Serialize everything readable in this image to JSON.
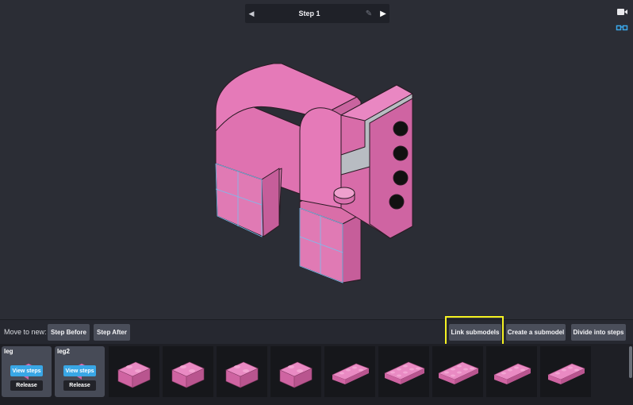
{
  "step_nav": {
    "title": "Step 1",
    "prev_icon": "triangle-left",
    "next_icon": "triangle-right",
    "edit_icon": "pencil"
  },
  "side_tools": [
    {
      "name": "camera-icon"
    },
    {
      "name": "glasses-icon",
      "color": "#3aa6e8"
    }
  ],
  "toolbar": {
    "move_label": "Move to new:",
    "step_before": "Step Before",
    "step_after": "Step After",
    "link_submodels": "Link submodels",
    "create_submodel": "Create a submodel",
    "divide_steps": "Divide into steps"
  },
  "submodels": [
    {
      "name": "leg",
      "view": "View steps",
      "release": "Release"
    },
    {
      "name": "leg2",
      "view": "View steps",
      "release": "Release"
    }
  ],
  "parts": [
    {
      "kind": "brick-1x2"
    },
    {
      "kind": "brick-1x2"
    },
    {
      "kind": "brick-1x2"
    },
    {
      "kind": "brick-1x2"
    },
    {
      "kind": "plate-1x4"
    },
    {
      "kind": "plate-2x4"
    },
    {
      "kind": "plate-2x4"
    },
    {
      "kind": "plate-1x4"
    },
    {
      "kind": "plate-1x4"
    }
  ],
  "colors": {
    "brick": "#df76b3",
    "highlight": "#f5f222",
    "accent": "#39a7e6"
  }
}
